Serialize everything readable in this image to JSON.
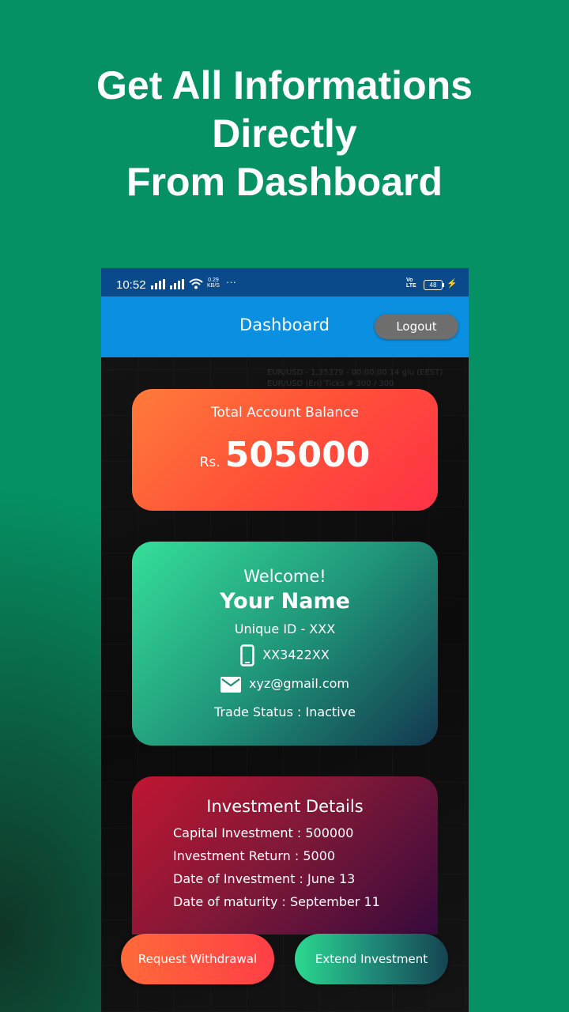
{
  "promo": {
    "headline_lines": [
      "Get All Informations",
      "Directly",
      "From Dashboard"
    ]
  },
  "status_bar": {
    "time": "10:52",
    "net_speed_value": "0.29",
    "net_speed_unit": "KB/S",
    "more": "···",
    "volte_line1": "Vo",
    "volte_line2": "LTE",
    "battery": "48"
  },
  "app_bar": {
    "title": "Dashboard",
    "logout_label": "Logout"
  },
  "background_ticker": {
    "line1": "EUR/USD - 1,35379 - 00:00:00 14 giu (EEST)",
    "line2": "EUR/USD (Eri) Ticks # 300 / 300"
  },
  "balance": {
    "label": "Total Account Balance",
    "currency": "Rs.",
    "amount": "505000"
  },
  "profile": {
    "welcome": "Welcome!",
    "name": "Your Name",
    "unique_id": "Unique ID - XXX",
    "phone": "XX3422XX",
    "email": "xyz@gmail.com",
    "trade_status": "Trade Status : Inactive"
  },
  "investment": {
    "title": "Investment Details",
    "lines": [
      "Capital Investment : 500000",
      "Investment Return : 5000",
      "Date of Investment : June 13",
      "Date of maturity : September 11"
    ]
  },
  "actions": {
    "withdraw_label": "Request Withdrawal",
    "extend_label": "Extend Investment"
  },
  "colors": {
    "page_green": "#059163",
    "status_bar": "#0a4a8a",
    "app_bar": "#0b8fe0",
    "logout_button": "#6e6e6e"
  },
  "icons": {
    "phone": "smartphone-icon",
    "email": "envelope-icon",
    "wifi": "wifi-icon",
    "signal": "signal-icon",
    "battery": "battery-icon",
    "charging": "bolt-icon"
  }
}
